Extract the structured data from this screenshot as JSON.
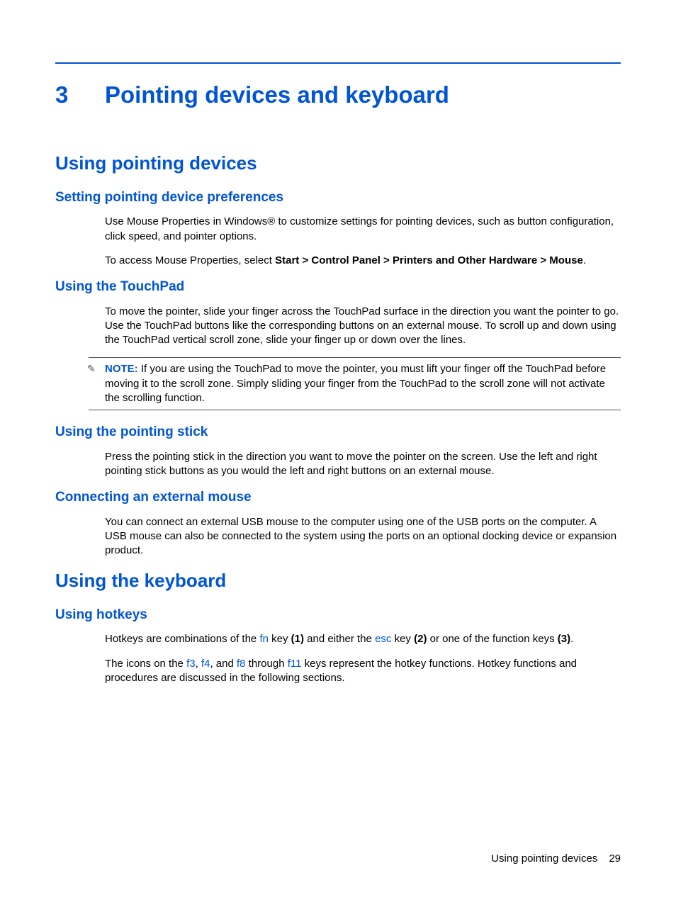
{
  "chapter": {
    "number": "3",
    "title": "Pointing devices and keyboard"
  },
  "s1": {
    "title": "Using pointing devices",
    "pref": {
      "title": "Setting pointing device preferences",
      "p1": "Use Mouse Properties in Windows® to customize settings for pointing devices, such as button configuration, click speed, and pointer options.",
      "p2a": "To access Mouse Properties, select ",
      "p2b": "Start > Control Panel > Printers and Other Hardware > Mouse",
      "p2c": "."
    },
    "touch": {
      "title": "Using the TouchPad",
      "p1": "To move the pointer, slide your finger across the TouchPad surface in the direction you want the pointer to go. Use the TouchPad buttons like the corresponding buttons on an external mouse. To scroll up and down using the TouchPad vertical scroll zone, slide your finger up or down over the lines.",
      "note_label": "NOTE:",
      "note": "If you are using the TouchPad to move the pointer, you must lift your finger off the TouchPad before moving it to the scroll zone. Simply sliding your finger from the TouchPad to the scroll zone will not activate the scrolling function."
    },
    "stick": {
      "title": "Using the pointing stick",
      "p1": "Press the pointing stick in the direction you want to move the pointer on the screen. Use the left and right pointing stick buttons as you would the left and right buttons on an external mouse."
    },
    "ext": {
      "title": "Connecting an external mouse",
      "p1": "You can connect an external USB mouse to the computer using one of the USB ports on the computer. A USB mouse can also be connected to the system using the ports on an optional docking device or expansion product."
    }
  },
  "s2": {
    "title": "Using the keyboard",
    "hot": {
      "title": "Using hotkeys",
      "p1": {
        "a": "Hotkeys are combinations of the ",
        "fn": "fn",
        "b": " key ",
        "b1": "(1)",
        "c": " and either the ",
        "esc": "esc",
        "d": " key ",
        "b2": "(2)",
        "e": " or one of the function keys ",
        "b3": "(3)",
        "f": "."
      },
      "p2": {
        "a": "The icons on the ",
        "f3": "f3",
        "b": ", ",
        "f4": "f4",
        "c": ", and ",
        "f8": "f8",
        "d": " through ",
        "f11": "f11",
        "e": " keys represent the hotkey functions. Hotkey functions and procedures are discussed in the following sections."
      }
    }
  },
  "footer": {
    "section": "Using pointing devices",
    "page": "29"
  }
}
